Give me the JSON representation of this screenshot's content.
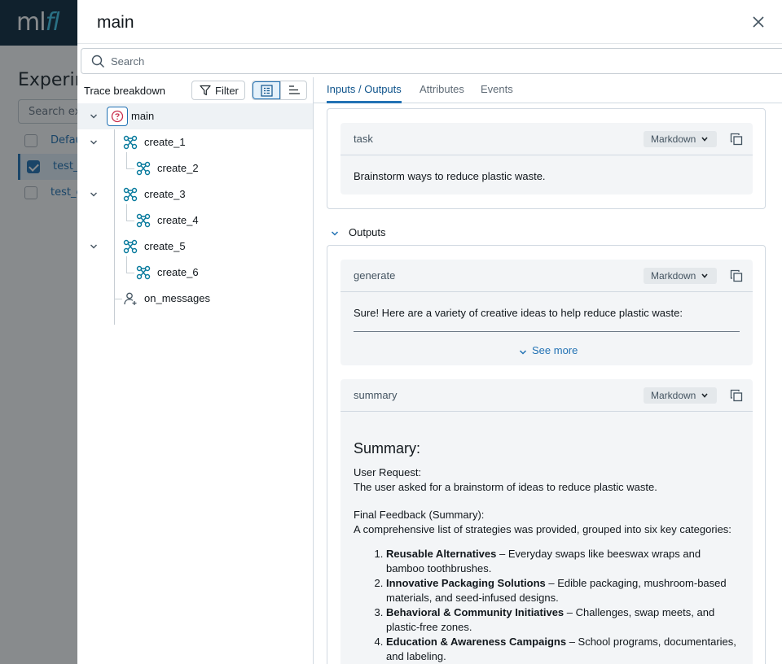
{
  "background": {
    "logo_prefix": "ml",
    "logo_suffix": "fl",
    "title": "Experim",
    "search_placeholder": "Search exp",
    "rows": [
      {
        "label": "Defau",
        "checked": false
      },
      {
        "label": "test_a",
        "checked": true
      },
      {
        "label": "test_c",
        "checked": false
      }
    ]
  },
  "drawer": {
    "title": "main",
    "search_placeholder": "Search"
  },
  "left_pane": {
    "label": "Trace breakdown",
    "filter_label": "Filter"
  },
  "tree": {
    "nodes": [
      {
        "label": "main",
        "icon": "question-icon",
        "level": 0,
        "expandable": true
      },
      {
        "label": "create_1",
        "icon": "chain-icon",
        "level": 1,
        "expandable": true
      },
      {
        "label": "create_2",
        "icon": "chain-icon",
        "level": 2,
        "expandable": false
      },
      {
        "label": "create_3",
        "icon": "chain-icon",
        "level": 1,
        "expandable": true
      },
      {
        "label": "create_4",
        "icon": "chain-icon",
        "level": 2,
        "expandable": false
      },
      {
        "label": "create_5",
        "icon": "chain-icon",
        "level": 1,
        "expandable": true
      },
      {
        "label": "create_6",
        "icon": "chain-icon",
        "level": 2,
        "expandable": false
      },
      {
        "label": "on_messages",
        "icon": "user-icon",
        "level": 1,
        "expandable": false
      }
    ]
  },
  "tabs": [
    "Inputs / Outputs",
    "Attributes",
    "Events"
  ],
  "inputs": {
    "key": "task",
    "format": "Markdown",
    "value": "Brainstorm ways to reduce plastic waste."
  },
  "outputs": {
    "section_label": "Outputs",
    "generate": {
      "key": "generate",
      "format": "Markdown",
      "value": "Sure! Here are a variety of creative ideas to help reduce plastic waste:",
      "see_more": "See more"
    },
    "summary": {
      "key": "summary",
      "format": "Markdown",
      "heading": "Summary:",
      "user_request_label": "User Request:",
      "user_request_text": "The user asked for a brainstorm of ideas to reduce plastic waste.",
      "final_feedback_label": "Final Feedback (Summary):",
      "final_feedback_text": "A comprehensive list of strategies was provided, grouped into six key categories:",
      "items": [
        {
          "bold": "Reusable Alternatives",
          "text": " – Everyday swaps like beeswax wraps and bamboo toothbrushes."
        },
        {
          "bold": "Innovative Packaging Solutions",
          "text": " – Edible packaging, mushroom-based materials, and seed-infused designs."
        },
        {
          "bold": "Behavioral & Community Initiatives",
          "text": " – Challenges, swap meets, and plastic-free zones."
        },
        {
          "bold": "Education & Awareness Campaigns",
          "text": " – School programs, documentaries, and labeling."
        }
      ]
    }
  },
  "colors": {
    "accent": "#2272b4",
    "topbar": "#0e2a3f",
    "icon_teal": "#077a9d",
    "root_icon": "#c82d4c"
  }
}
